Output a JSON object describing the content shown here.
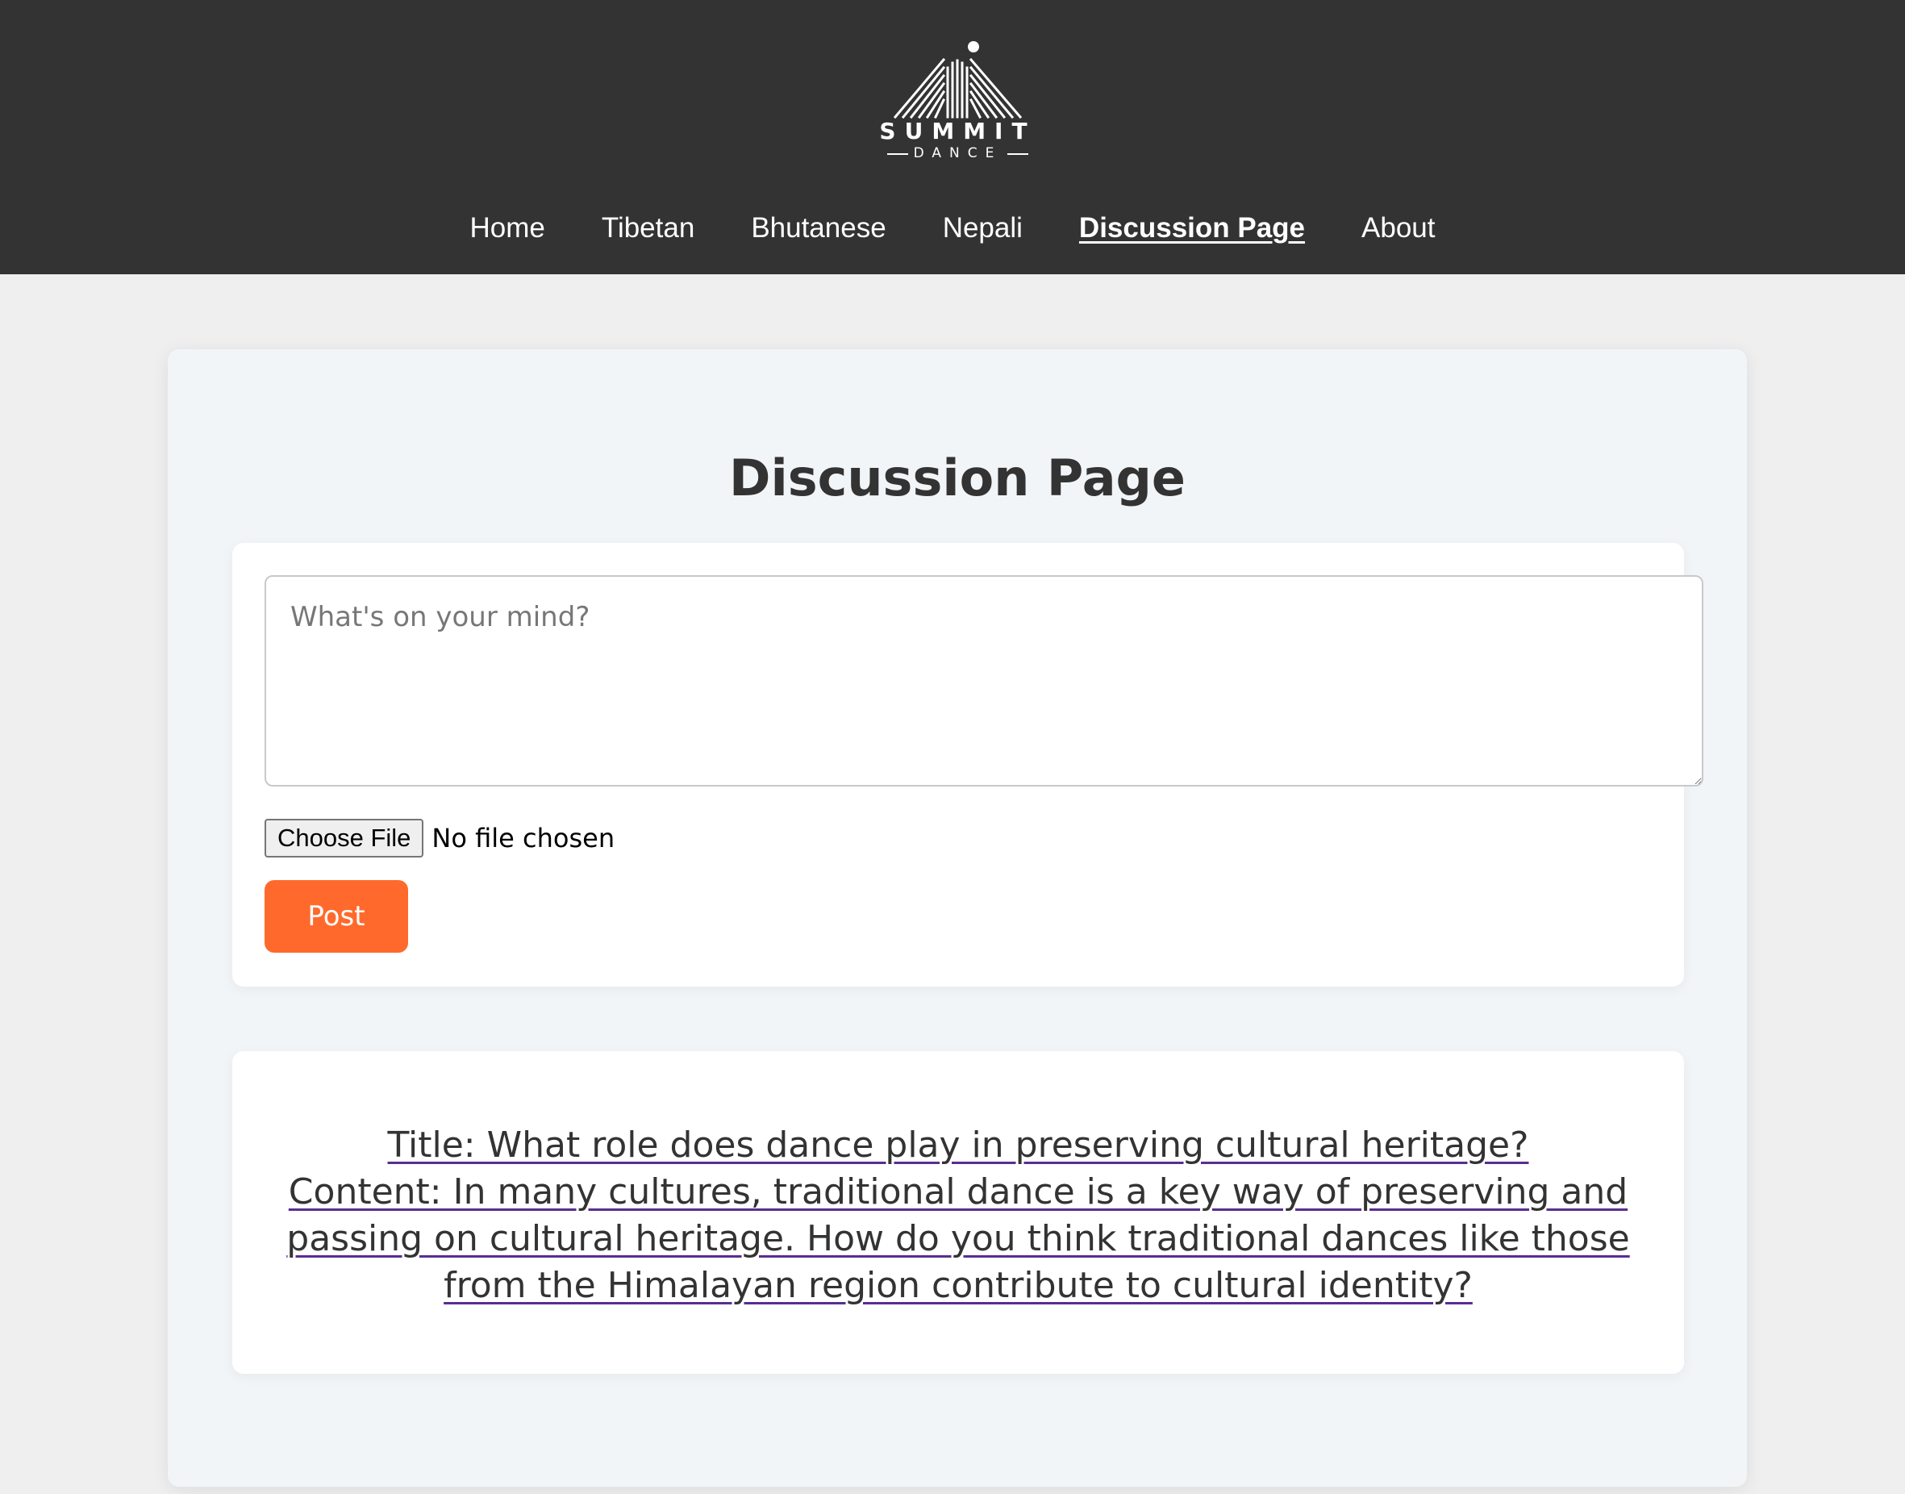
{
  "brand": {
    "name": "SUMMIT",
    "tagline": "DANCE"
  },
  "nav": {
    "items": [
      {
        "label": "Home",
        "active": false
      },
      {
        "label": "Tibetan",
        "active": false
      },
      {
        "label": "Bhutanese",
        "active": false
      },
      {
        "label": "Nepali",
        "active": false
      },
      {
        "label": "Discussion Page",
        "active": true
      },
      {
        "label": "About",
        "active": false
      }
    ]
  },
  "main": {
    "title": "Discussion Page",
    "form": {
      "placeholder": "What's on your mind?",
      "value": "",
      "file_button_label": "Choose File",
      "file_status": "No file chosen",
      "post_label": "Post"
    },
    "posts": [
      {
        "title_line": "Title: What role does dance play in preserving cultural heritage?",
        "content_line": "Content: In many cultures, traditional dance is a key way of preserving and passing on cultural heritage. How do you think traditional dances like those from the Himalayan region contribute to cultural identity?"
      }
    ]
  },
  "colors": {
    "header_bg": "#333333",
    "page_bg": "#efefef",
    "container_bg": "#f2f5f8",
    "card_bg": "#ffffff",
    "accent": "#ff6a2c",
    "link_underline": "#5a2d91",
    "text": "#333333"
  },
  "icons": {
    "logo": "summit-dance-mountain-logo"
  }
}
